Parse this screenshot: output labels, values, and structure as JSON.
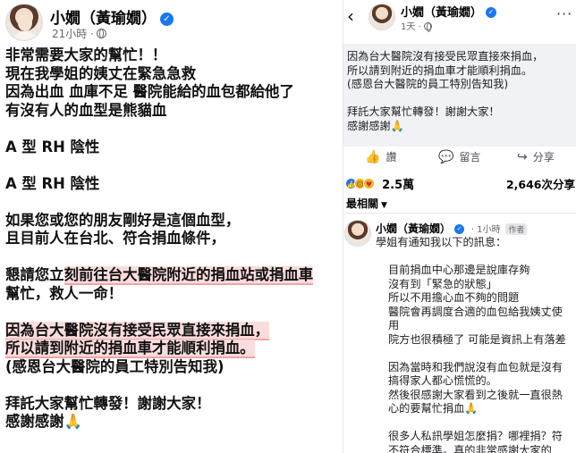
{
  "left": {
    "author": "小嫺（黃瑜嫺）",
    "time": "21小時 ·",
    "lines": [
      "非常需要大家的幫忙！！",
      "現在我學姐的姨丈在緊急急救",
      "因為出血 血庫不足 醫院能給的血包都給他了",
      "有沒有人的血型是熊貓血",
      "",
      "A 型 RH 陰性",
      "",
      "A 型 RH 陰性",
      "",
      "如果您或您的朋友剛好是這個血型，",
      "且目前人在台北、符合捐血條件，",
      "",
      "懇請您立刻前往台大醫院附近的捐血站或捐血車",
      "幫忙，救人一命！",
      "",
      "因為台大醫院沒有接受民眾直接來捐血，",
      "所以請到附近的捐血車才能順利捐血。",
      "(感恩台大醫院的員工特別告知我)",
      "",
      "拜託大家幫忙轉發！謝謝大家！",
      "感謝感謝🙏"
    ]
  },
  "right": {
    "author": "小嫺（黃瑜嫺）",
    "time": "1天 ·",
    "post_lines": [
      "因為台大醫院沒有接受民眾直接來捐血，",
      "所以請到附近的捐血車才能順利捐血。",
      "(感恩台大醫院的員工特別告知我)",
      "",
      "拜託大家幫忙轉發！謝謝大家！",
      "感謝感謝🙏"
    ],
    "actions": {
      "like": "讚",
      "comment": "留言",
      "share": "分享"
    },
    "reaction_count": "2.5萬",
    "share_count": "2,646次分享",
    "sort_label": "最相關",
    "comment": {
      "author": "小嫺（黃瑜嫺）",
      "time": "1小時",
      "tag": "作者",
      "lines": [
        {
          "text": "學姐有通知我以下的訊息：",
          "indent": false
        },
        {
          "text": "",
          "indent": false
        },
        {
          "text": "目前捐血中心那邊是說庫存夠",
          "indent": true
        },
        {
          "text": "沒有到「緊急的狀態」",
          "indent": true
        },
        {
          "text": "所以不用擔心血不夠的問題",
          "indent": true
        },
        {
          "text": "醫院會再調度合適的血包給我姨丈使",
          "indent": true
        },
        {
          "text": "用",
          "indent": true
        },
        {
          "text": "院方也很積極了 可能是資訊上有落差",
          "indent": true
        },
        {
          "text": "",
          "indent": false
        },
        {
          "text": "因為當時和我們說沒有血包就是沒有",
          "indent": true
        },
        {
          "text": "搞得家人都心慌慌的。",
          "indent": true
        },
        {
          "text": "然後很感謝大家看到之後就一直很熱",
          "indent": true
        },
        {
          "text": "心的要幫忙捐血🙏",
          "indent": true
        },
        {
          "text": "",
          "indent": false
        },
        {
          "text": "很多人私訊學姐怎麼捐？哪裡捐？符",
          "indent": true
        },
        {
          "text": "不符合標準。真的非常感謝大家的",
          "indent": true
        }
      ]
    }
  },
  "colors": {
    "verified": "#1877f2",
    "highlight": "#fbdcdc",
    "post_bg": "#f0f2f5",
    "meta": "#65676b"
  }
}
